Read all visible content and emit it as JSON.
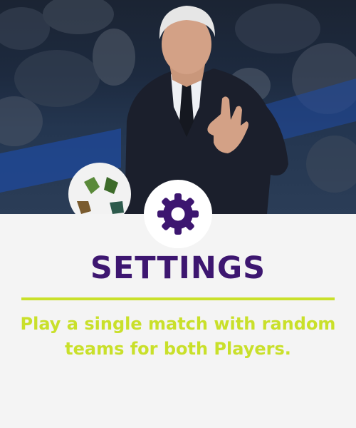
{
  "hero": {
    "photo": "manager-gesturing-photo"
  },
  "icon": {
    "name": "gear-icon",
    "color": "#3d1670"
  },
  "title": "SETTINGS",
  "description": "Play a single match with random teams for both Players.",
  "colors": {
    "title": "#3d1670",
    "accent": "#c9e02a",
    "background": "#f4f4f4"
  }
}
